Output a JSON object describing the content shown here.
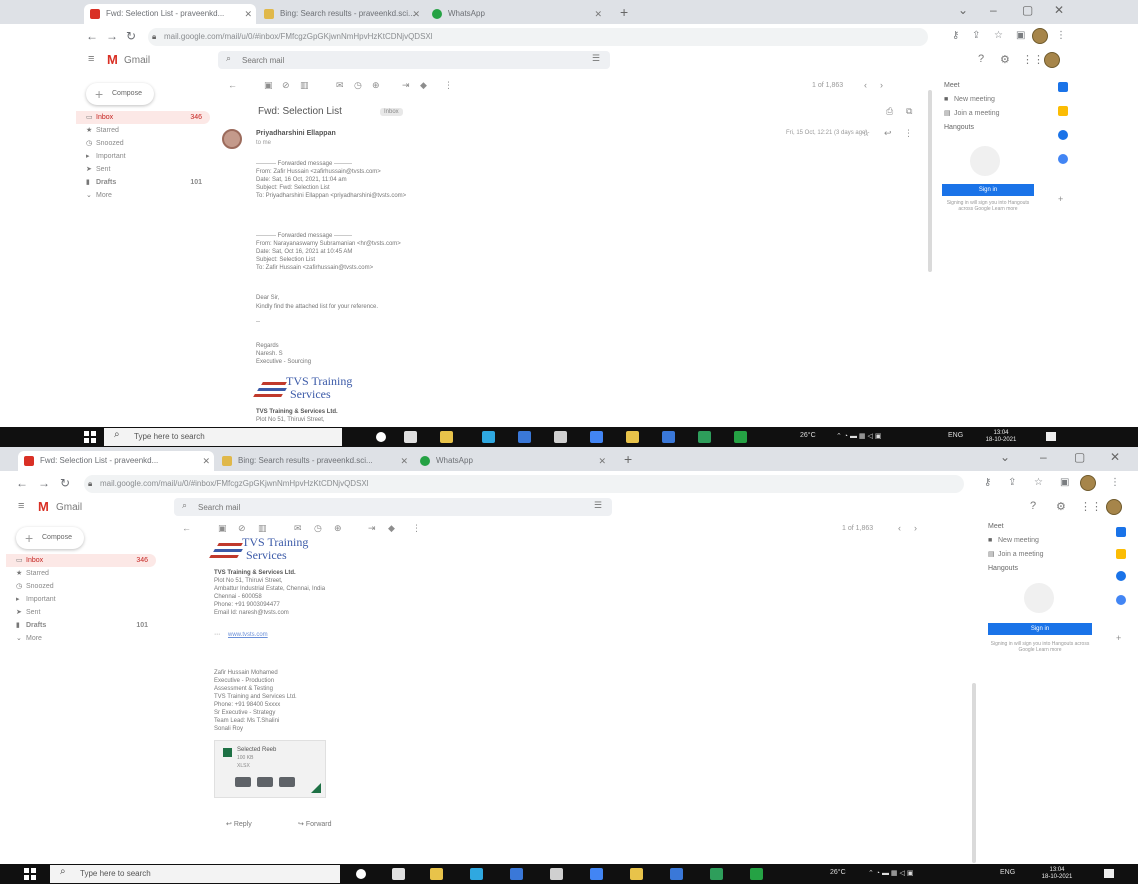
{
  "browser": {
    "tabs": [
      {
        "label": "Fwd: Selection List - praveenkd..."
      },
      {
        "label": "Bing: Search results - praveenkd.sci..."
      },
      {
        "label": "WhatsApp"
      }
    ],
    "new_tab": "+",
    "url_top": "mail.google.com/mail/u/0/#inbox/FMfcgzGpGKjwnNmHpvHzKtCDNjvQDSXl",
    "url_bottom": "mail.google.com/mail/u/0/#inbox/FMfcgzGpGKjwnNmHpvHzKtCDNjvQDSXl"
  },
  "gmail": {
    "logo_text": "Gmail",
    "search_placeholder": "Search mail",
    "compose_label": "Compose",
    "nav": [
      {
        "label": "Inbox",
        "count": "346"
      },
      {
        "label": "Starred",
        "count": ""
      },
      {
        "label": "Snoozed",
        "count": ""
      },
      {
        "label": "Important",
        "count": ""
      },
      {
        "label": "Sent",
        "count": ""
      },
      {
        "label": "Drafts",
        "count": "101"
      },
      {
        "label": "More",
        "count": ""
      }
    ],
    "pager": "1 of 1,863",
    "subject": "Fwd: Selection List",
    "inbox_badge": "Inbox",
    "sender_name": "Priyadharshini Ellappan",
    "sender_to": "to me",
    "date": "Fri, 15 Oct, 12:21 (3 days ago)",
    "body_lines": [
      {
        "text": "---------- Forwarded message ---------",
        "style": "normal"
      },
      {
        "text": "From: Zafir Hussain <zafirhussain@tvsts.com>",
        "style": "normal"
      },
      {
        "text": "Date: Sat, 16 Oct, 2021, 11:04 am",
        "style": "normal"
      },
      {
        "text": "Subject: Fwd: Selection List",
        "style": "normal"
      },
      {
        "text": "To: Priyadharshini Ellappan <priyadharshini@tvsts.com>",
        "style": "normal"
      },
      {
        "text": "",
        "style": "normal"
      },
      {
        "text": "",
        "style": "normal"
      },
      {
        "text": "",
        "style": "normal"
      },
      {
        "text": "",
        "style": "normal"
      },
      {
        "text": "---------- Forwarded message ---------",
        "style": "normal"
      },
      {
        "text": "From: Narayanaswamy Subramanian <hr@tvsts.com>",
        "style": "normal"
      },
      {
        "text": "Date: Sat, Oct 16, 2021 at 10:45 AM",
        "style": "normal"
      },
      {
        "text": "Subject: Selection List",
        "style": "normal"
      },
      {
        "text": "To: Zafir Hussain <zafirhussain@tvsts.com>",
        "style": "normal"
      }
    ],
    "greeting": "Dear Sir,",
    "body_text": "Kindly find the attached list for your reference.",
    "dash": "--",
    "thanks": "Regards",
    "sign_name": "Naresh. S",
    "sign_role": "Executive - Sourcing",
    "logo_line1": "TVS Training",
    "logo_line2": "Services",
    "company_name": "TVS Training & Services Ltd.",
    "address_lines": [
      "Plot No 51, Thiruvi Street,",
      "Ambattur Industrial Estate, Chennai, India",
      "Chennai - 600058",
      "Phone: +91 9003094477",
      "Email Id: naresh@tvsts.com"
    ],
    "link_more": "www.tvsts.com",
    "footer_lines": [
      "Zafir Hussain Mohamed",
      "Executive - Production",
      "Assessment & Testing",
      "TVS Training and Services Ltd.",
      "Phone: +91 98400 5xxxx",
      "Sr Executive - Strategy",
      "Team Lead: Ms T.Shalini",
      "Sonali Roy"
    ],
    "attachment_name": "Selected Reeb",
    "attachment_size": "100 KB",
    "attachment_type": "XLSX",
    "reply_label": "Reply",
    "forward_label": "Forward"
  },
  "right_panel": {
    "meet_heading": "Meet",
    "meet_new": "New meeting",
    "meet_join": "Join a meeting",
    "hangouts_heading": "Hangouts",
    "signin_label": "Sign in",
    "signin_note": "Signing in will sign you into Hangouts across Google Learn more"
  },
  "taskbar": {
    "search_placeholder": "Type here to search",
    "weather": "26°C",
    "lang": "ENG",
    "time": "13:04",
    "date": "18-10-2021"
  },
  "colors": {
    "gmail_red": "#d93025",
    "accent_blue": "#1a73e8",
    "taskbar": "#101010"
  }
}
